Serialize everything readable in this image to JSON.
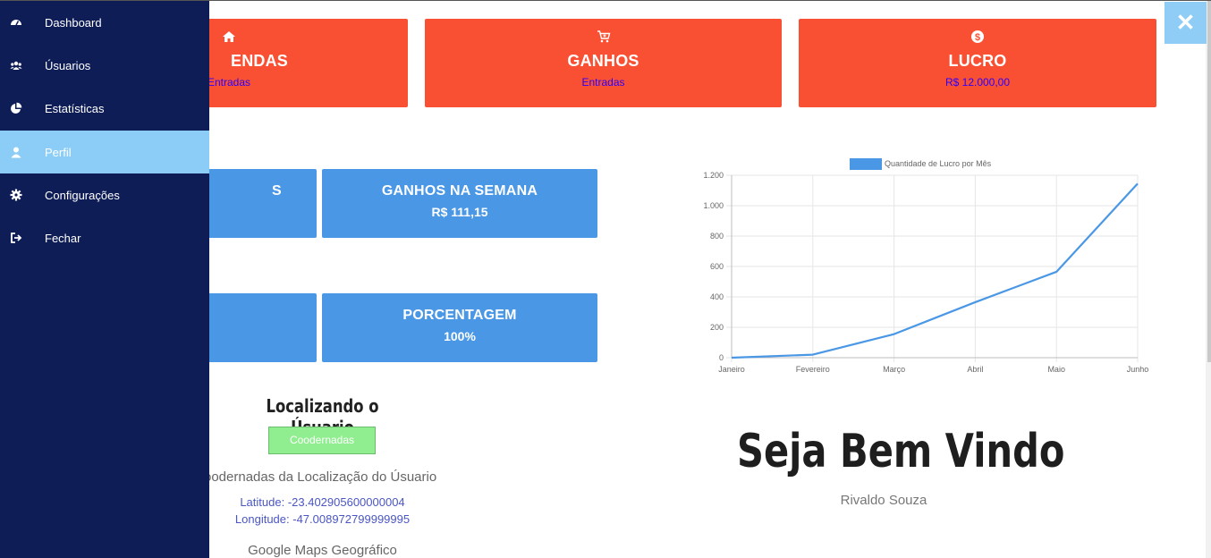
{
  "colors": {
    "sidebar": "#0f1d57",
    "sidebar_active": "#8bcdf7",
    "card_red": "#f95033",
    "card_blue": "#4a97e6",
    "sub_text": "#2b00ff",
    "close_btn": "#8fcdf6",
    "coord_btn": "#90ee90",
    "chart_line": "#4a97e6"
  },
  "sidebar": {
    "items": [
      {
        "label": "Dashboard",
        "icon": "dashboard-icon"
      },
      {
        "label": "Úsuarios",
        "icon": "users-icon"
      },
      {
        "label": "Estatísticas",
        "icon": "pie-chart-icon"
      },
      {
        "label": "Perfil",
        "icon": "user-icon",
        "active": true
      },
      {
        "label": "Configurações",
        "icon": "gear-icon"
      },
      {
        "label": "Fechar",
        "icon": "sign-out-icon"
      }
    ]
  },
  "close": {
    "label": "✕"
  },
  "cards": [
    {
      "title": "ENDAS",
      "sub": "Entradas",
      "icon": "home-icon"
    },
    {
      "title": "GANHOS",
      "sub": "Entradas",
      "icon": "cart-icon"
    },
    {
      "title": "LUCRO",
      "sub": "R$ 12.000,00",
      "icon": "dollar-icon"
    }
  ],
  "blue_cards": [
    {
      "title": "S",
      "sub": ""
    },
    {
      "title": "GANHOS NA SEMANA",
      "sub": "R$ 111,15"
    },
    {
      "title": "",
      "sub": ""
    },
    {
      "title": "PORCENTAGEM",
      "sub": "100%"
    }
  ],
  "location": {
    "title": "Localizando o Úsuario",
    "button": "Coodernadas",
    "heading": "oodernadas da Localização do Úsuario",
    "latitude": "Latitude: -23.402905600000004",
    "longitude": "Longitude: -47.008972799999995",
    "maps_title": "Google Maps Geográfico"
  },
  "welcome": {
    "title": "Seja Bem Vindo",
    "user": "Rivaldo Souza"
  },
  "chart_data": {
    "type": "line",
    "categories": [
      "Janeiro",
      "Fevereiro",
      "Março",
      "Abril",
      "Maio",
      "Junho"
    ],
    "series": [
      {
        "name": "Quantidade de Lucro por Mês",
        "values": [
          0,
          20,
          155,
          365,
          565,
          1145
        ]
      }
    ],
    "ylim": [
      0,
      1200
    ],
    "yticks": [
      0,
      200,
      400,
      600,
      800,
      1000,
      1200
    ],
    "ytick_labels": [
      "0",
      "200",
      "400",
      "600",
      "800",
      "1.000",
      "1.200"
    ],
    "grid": true,
    "legend": "top"
  }
}
